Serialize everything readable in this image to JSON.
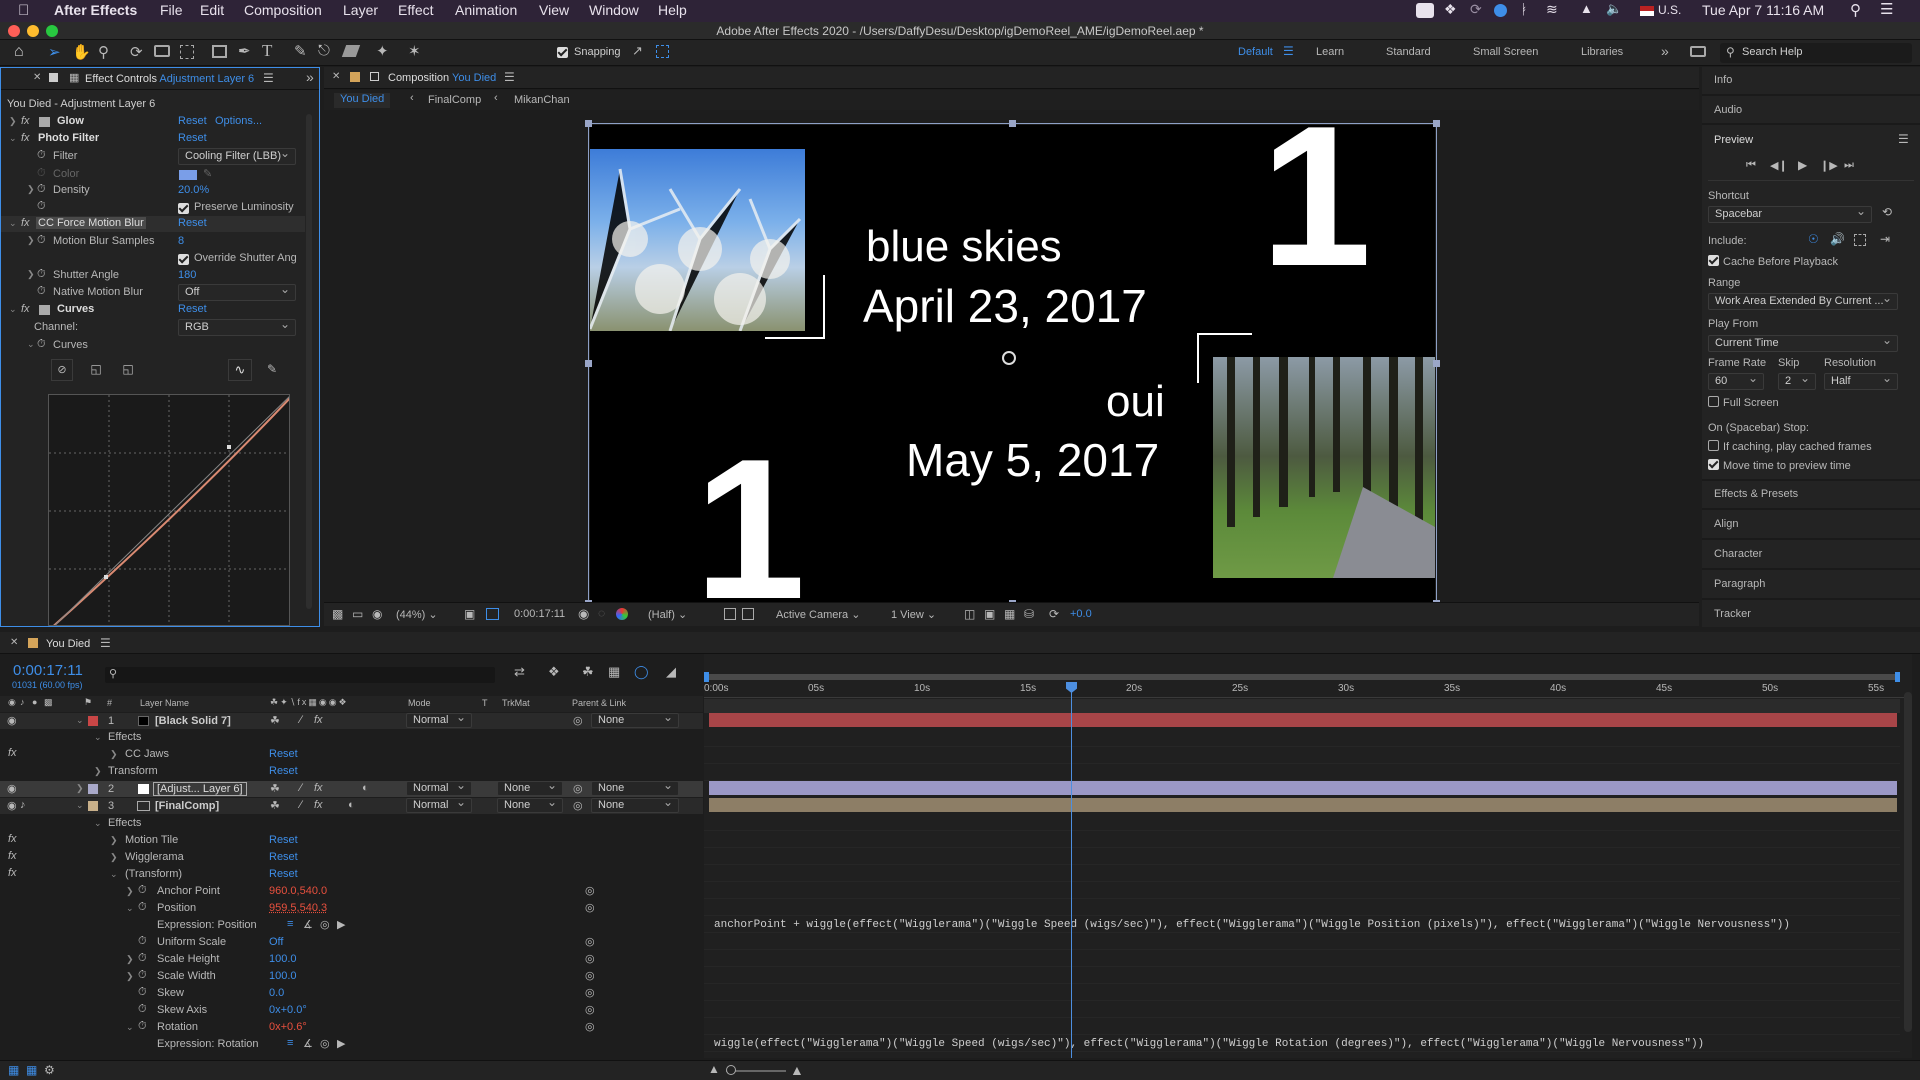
{
  "menubar": {
    "app": "After Effects",
    "items": [
      "File",
      "Edit",
      "Composition",
      "Layer",
      "Effect",
      "Animation",
      "View",
      "Window",
      "Help"
    ],
    "input_source": "U.S.",
    "clock": "Tue Apr 7  11:16 AM"
  },
  "window": {
    "title": "Adobe After Effects 2020 - /Users/DaffyDesu/Desktop/igDemoReel_AME/igDemoReel.aep *"
  },
  "toolbar": {
    "snapping_label": "Snapping",
    "workspaces": [
      "Default",
      "Learn",
      "Standard",
      "Small Screen",
      "Libraries"
    ],
    "active_workspace": "Default",
    "search_placeholder": "Search Help"
  },
  "effect_controls": {
    "tab_prefix": "Effect Controls",
    "tab_layer": "Adjustment Layer 6",
    "subtitle": "You Died - Adjustment Layer 6",
    "glow": {
      "name": "Glow",
      "reset": "Reset",
      "options": "Options..."
    },
    "photo_filter": {
      "name": "Photo Filter",
      "reset": "Reset",
      "filter_label": "Filter",
      "filter_value": "Cooling Filter (LBB)",
      "color_label": "Color",
      "density_label": "Density",
      "density_value": "20.0%",
      "preserve_label": "Preserve Luminosity"
    },
    "motion_blur": {
      "name": "CC Force Motion Blur",
      "reset": "Reset",
      "samples_label": "Motion Blur Samples",
      "samples_value": "8",
      "override_label": "Override Shutter Ang",
      "angle_label": "Shutter Angle",
      "angle_value": "180",
      "native_label": "Native Motion Blur",
      "native_value": "Off"
    },
    "curves": {
      "name": "Curves",
      "reset": "Reset",
      "channel_label": "Channel:",
      "channel_value": "RGB",
      "curves_label": "Curves"
    }
  },
  "composition": {
    "tab_prefix": "Composition",
    "tab_name": "You Died",
    "breadcrumbs": [
      "You Died",
      "FinalComp",
      "MikanChan"
    ],
    "text_line1": "blue skies",
    "text_line2": "April 23, 2017",
    "text_line3": "oui",
    "text_line4": "May 5, 2017",
    "big_char": "1",
    "footer": {
      "zoom": "(44%)",
      "timecode": "0:00:17:11",
      "resolution": "(Half)",
      "camera": "Active Camera",
      "views": "1 View",
      "exposure": "+0.0"
    }
  },
  "right_panel": {
    "sections": [
      "Info",
      "Audio"
    ],
    "preview_title": "Preview",
    "shortcut_label": "Shortcut",
    "shortcut_value": "Spacebar",
    "include_label": "Include:",
    "cache_label": "Cache Before Playback",
    "range_label": "Range",
    "range_value": "Work Area Extended By Current ...",
    "play_from_label": "Play From",
    "play_from_value": "Current Time",
    "frame_rate_label": "Frame Rate",
    "skip_label": "Skip",
    "resolution_label": "Resolution",
    "frame_rate_value": "60",
    "skip_value": "2",
    "resolution_value": "Half",
    "full_screen_label": "Full Screen",
    "stop_label": "On (Spacebar) Stop:",
    "stop_opt1": "If caching, play cached frames",
    "stop_opt2": "Move time to preview time",
    "more_sections": [
      "Effects & Presets",
      "Align",
      "Character",
      "Paragraph",
      "Tracker"
    ]
  },
  "timeline": {
    "tab_name": "You Died",
    "timecode": "0:00:17:11",
    "frame_info": "01031 (60.00 fps)",
    "headers": {
      "num": "#",
      "layer_name": "Layer Name",
      "mode": "Mode",
      "t": "T",
      "trkmat": "TrkMat",
      "parent": "Parent & Link"
    },
    "ruler": [
      "0:00s",
      "05s",
      "10s",
      "15s",
      "20s",
      "25s",
      "30s",
      "35s",
      "40s",
      "45s",
      "50s",
      "55s"
    ],
    "effects_label": "Effects",
    "transform_label": "Transform",
    "reset": "Reset",
    "layer1": {
      "num": "1",
      "name": "[Black Solid 7]",
      "mode": "Normal",
      "parent": "None",
      "effect": "CC Jaws"
    },
    "layer2": {
      "num": "2",
      "name": "[Adjust... Layer 6]",
      "mode": "Normal",
      "trkmat": "None",
      "parent": "None"
    },
    "layer3": {
      "num": "3",
      "name": "[FinalComp]",
      "mode": "Normal",
      "trkmat": "None",
      "parent": "None"
    },
    "layer3_effects": [
      "Motion Tile",
      "Wigglerama",
      "(Transform)"
    ],
    "props": {
      "anchor_label": "Anchor Point",
      "anchor_value": "960.0,540.0",
      "position_label": "Position",
      "position_value": "959.5,540.3",
      "expr_pos_label": "Expression: Position",
      "uniform_label": "Uniform Scale",
      "uniform_value": "Off",
      "height_label": "Scale Height",
      "height_value": "100.0",
      "width_label": "Scale Width",
      "width_value": "100.0",
      "skew_label": "Skew",
      "skew_value": "0.0",
      "skew_axis_label": "Skew Axis",
      "skew_axis_value": "0x+0.0°",
      "rotation_label": "Rotation",
      "rotation_value": "0x+0.6°",
      "expr_rot_label": "Expression: Rotation"
    },
    "expr_position": "anchorPoint + wiggle(effect(\"Wigglerama\")(\"Wiggle Speed (wigs/sec)\"), effect(\"Wigglerama\")(\"Wiggle Position (pixels)\"), effect(\"Wigglerama\")(\"Wiggle Nervousness\"))",
    "expr_rotation": "wiggle(effect(\"Wigglerama\")(\"Wiggle Speed (wigs/sec)\"), effect(\"Wigglerama\")(\"Wiggle Rotation (degrees)\"), effect(\"Wigglerama\")(\"Wiggle Nervousness\"))"
  },
  "colors": {
    "accent": "#3e8ee8",
    "playhead": "#4d8fe0",
    "layer1_bar": "#a84548",
    "layer2_bar": "#9b98c6",
    "layer3_bar": "#8d7e66",
    "value_red": "#e8503e"
  }
}
